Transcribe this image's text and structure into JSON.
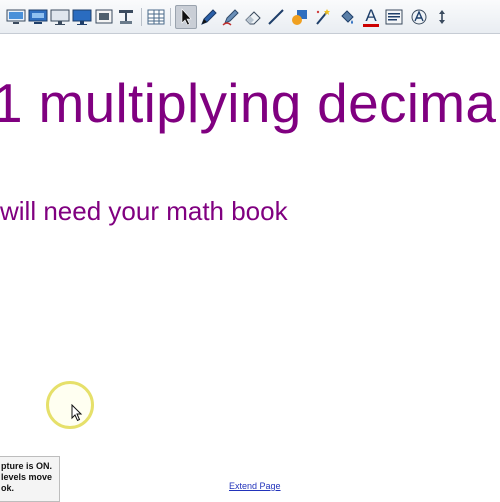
{
  "toolbar": {
    "tools": [
      {
        "name": "screen-capture-icon"
      },
      {
        "name": "desktop-icon"
      },
      {
        "name": "monitor-icon"
      },
      {
        "name": "display-icon"
      },
      {
        "name": "image-icon"
      },
      {
        "name": "document-camera-icon"
      },
      {
        "name": "table-icon"
      },
      {
        "name": "select-icon"
      },
      {
        "name": "pen-icon"
      },
      {
        "name": "creative-pen-icon"
      },
      {
        "name": "eraser-icon"
      },
      {
        "name": "line-icon"
      },
      {
        "name": "shapes-icon"
      },
      {
        "name": "magic-pen-icon"
      },
      {
        "name": "fill-icon"
      },
      {
        "name": "text-icon"
      },
      {
        "name": "text-format-icon"
      },
      {
        "name": "properties-icon"
      },
      {
        "name": "move-toolbar-icon"
      }
    ],
    "text_tool_glyph": "A",
    "accent_color": "#cc0000"
  },
  "main": {
    "title": "1 multiplying decima",
    "instruction": "will need your math book",
    "text_color": "#800080"
  },
  "notification": {
    "lines": [
      "pture is ON.",
      "levels move",
      "ok."
    ]
  },
  "footer": {
    "extend_page_label": "Extend Page"
  }
}
